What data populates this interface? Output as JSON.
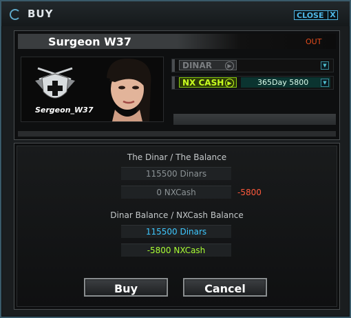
{
  "window": {
    "title": "BUY",
    "close_label": "CLOSE",
    "close_x": "X"
  },
  "item": {
    "name": "Surgeon W37",
    "status": "OUT",
    "username": "Sergeon_W37"
  },
  "currency": {
    "dinar_label": "DINAR",
    "dinar_value": "",
    "nx_label": "NX CASH",
    "nx_value": "365Day 5800"
  },
  "summary": {
    "label1": "The Dinar / The Balance",
    "dinar_total": "115500 Dinars",
    "nx_total": "0 NXCash",
    "nx_cost": "-5800",
    "label2": "Dinar Balance / NXCash Balance",
    "dinar_balance": "115500 Dinars",
    "nx_balance": "-5800 NXCash"
  },
  "buttons": {
    "buy": "Buy",
    "cancel": "Cancel"
  },
  "colors": {
    "accent": "#4fb8e8",
    "nx": "#c8ff20",
    "negative": "#ff5a3c",
    "balance_cyan": "#3ec8ff"
  }
}
